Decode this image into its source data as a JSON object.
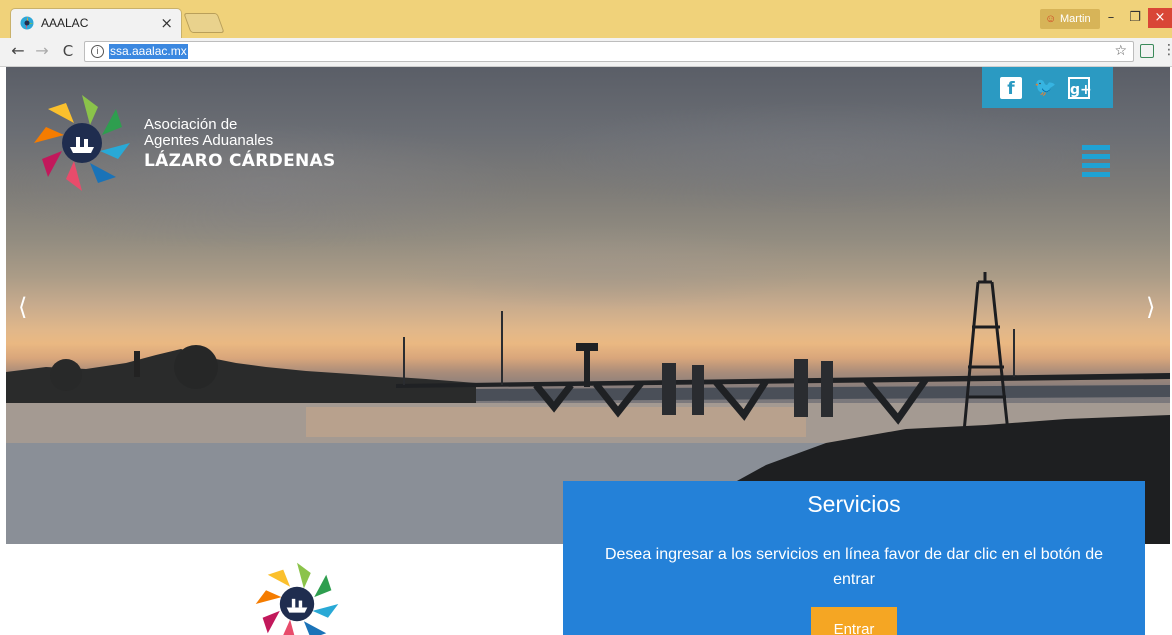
{
  "browser": {
    "tab_title": "AAALAC",
    "tab_close": "×",
    "profile_name": "Martin",
    "profile_icon": "☺",
    "minimize": "–",
    "maximize": "❐",
    "close": "×",
    "back": "←",
    "forward": "→",
    "reload": "C",
    "info_icon": "i",
    "url": "ssa.aaalac.mx",
    "bookmark_star": "☆",
    "menu": "⋮"
  },
  "site": {
    "org_line1": "Asociación de",
    "org_line2": "Agentes Aduanales",
    "org_name": "LÁZARO CÁRDENAS",
    "social": {
      "facebook": "f",
      "twitter": "🐦",
      "googleplus": "g+"
    },
    "carousel": {
      "prev": "⟨",
      "next": "⟩"
    }
  },
  "services": {
    "title": "Servicios",
    "text": "Desea ingresar a los servicios en línea favor de dar clic en el botón de entrar",
    "button": "Entrar"
  },
  "colors": {
    "tabbar": "#f0d27a",
    "social_bg": "#2b9ac2",
    "hamburger": "#1fa2d4",
    "services_bg": "#2481d8",
    "button_bg": "#f5a623"
  }
}
